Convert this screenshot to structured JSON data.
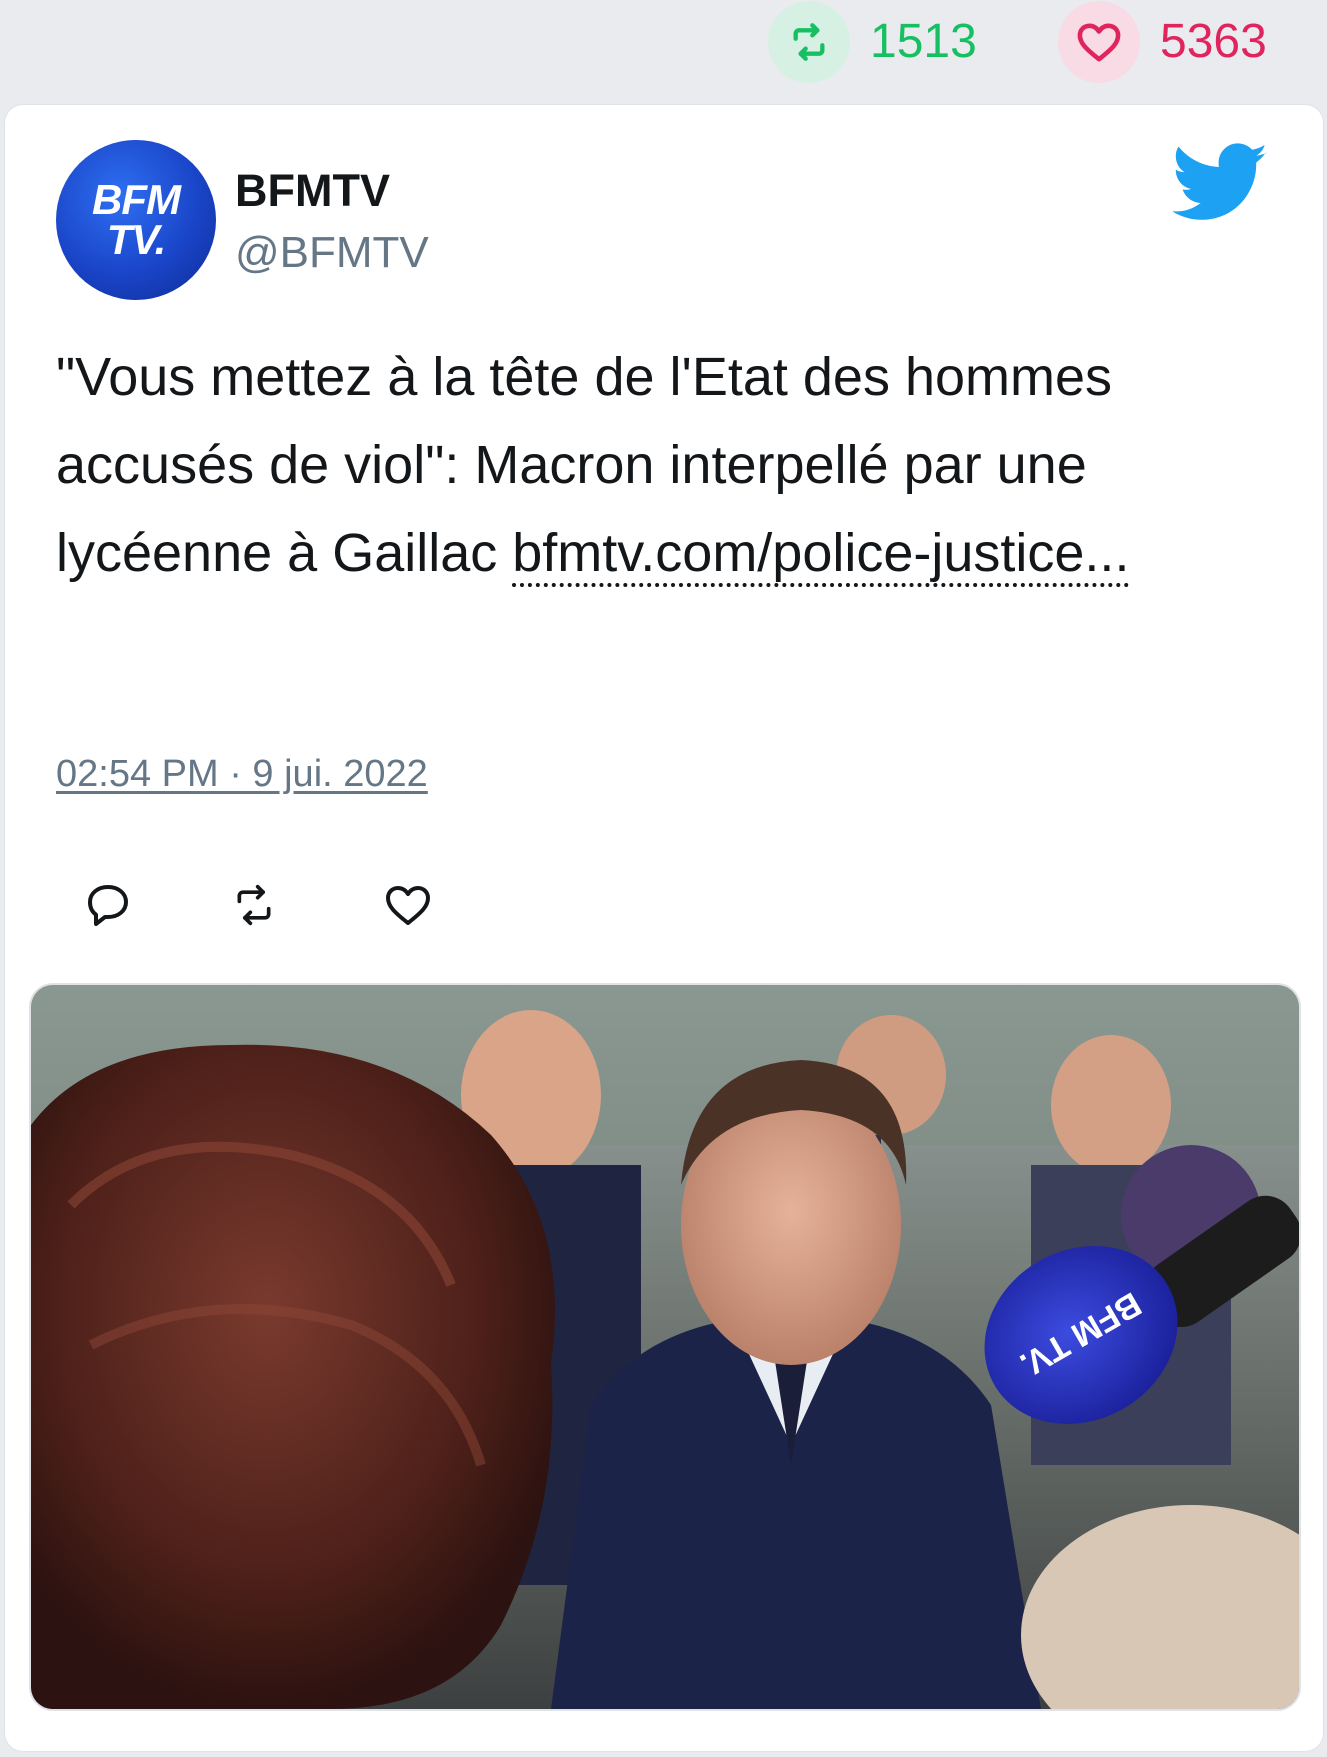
{
  "stats": {
    "retweet_count": "1513",
    "like_count": "5363",
    "retweet_icon": "retweet-icon",
    "like_icon": "heart-icon",
    "retweet_color": "#17bf63",
    "like_color": "#e0245e"
  },
  "author": {
    "display_name": "BFMTV",
    "handle": "@BFMTV",
    "avatar_text_line1": "BFM",
    "avatar_text_line2": "TV."
  },
  "tweet": {
    "text": "\"Vous mettez à la tête de l'Etat des hommes accusés de viol\": Macron interpellé par une lycéenne à Gaillac ",
    "link": "bfmtv.com/police-justice...",
    "timestamp": "02:54 PM · 9 jui. 2022"
  },
  "actions": {
    "reply_icon": "reply-icon",
    "retweet_icon": "retweet-icon",
    "like_icon": "heart-icon"
  },
  "media": {
    "microphone_text": "BFM TV."
  },
  "colors": {
    "twitter_blue": "#1da1f2",
    "text": "#14171a",
    "muted": "#657786"
  }
}
